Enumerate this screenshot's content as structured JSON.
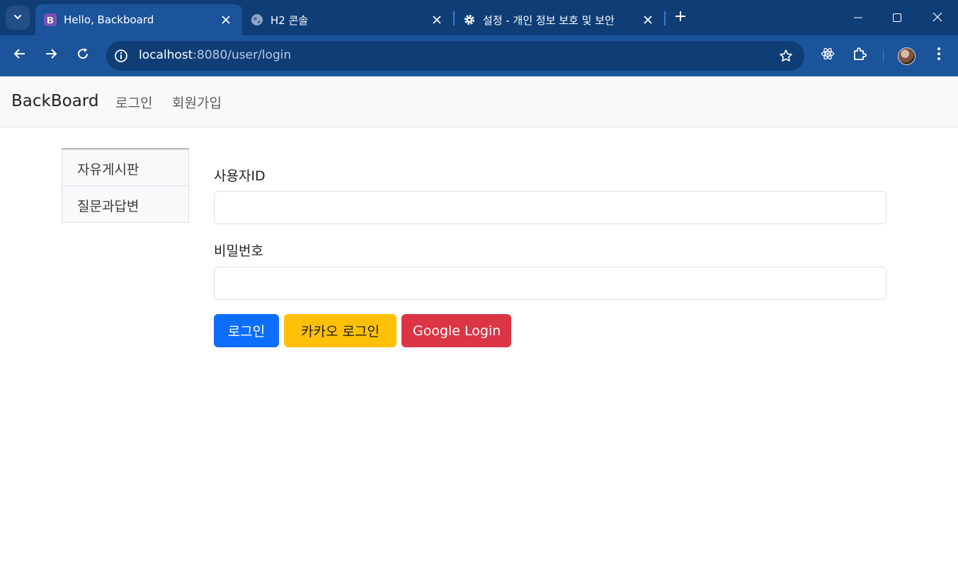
{
  "browser": {
    "tabs": [
      {
        "title": "Hello, Backboard",
        "favicon_letter": "B",
        "active": true
      },
      {
        "title": "H2 콘솔",
        "active": false
      },
      {
        "title": "설정 - 개인 정보 보호 및 보안",
        "active": false
      }
    ],
    "url_host": "localhost",
    "url_rest": ":8080/user/login",
    "icons": {
      "tab_search": "chevron-down-icon",
      "back": "arrow-left-icon",
      "forward": "arrow-right-icon",
      "reload": "reload-icon",
      "site_info": "info-icon",
      "bookmark": "star-icon",
      "extension_react": "react-atom-icon",
      "extensions": "puzzle-icon",
      "menu": "kebab-menu-icon"
    },
    "colors": {
      "tabbar": "#0f3e77",
      "toolbar": "#1b549b"
    }
  },
  "navbar": {
    "brand": "BackBoard",
    "links": [
      "로그인",
      "회원가입"
    ]
  },
  "sidebar": {
    "items": [
      "자유게시판",
      "질문과답변"
    ]
  },
  "form": {
    "username_label": "사용자ID",
    "username_value": "",
    "password_label": "비밀번호",
    "password_value": "",
    "buttons": {
      "login": "로그인",
      "kakao": "카카오 로그인",
      "google": "Google Login"
    },
    "colors": {
      "login": "#0d6efd",
      "kakao": "#ffc107",
      "google": "#dc3545"
    }
  }
}
